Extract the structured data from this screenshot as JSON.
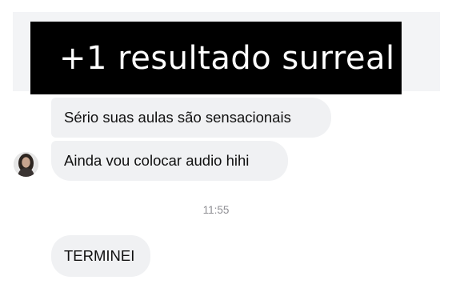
{
  "banner": {
    "text": "+1 resultado surreal"
  },
  "chat": {
    "messages": [
      {
        "text": "Sério suas aulas são sensacionais"
      },
      {
        "text": "Ainda vou colocar audio hihi"
      },
      {
        "text": "TERMINEI"
      }
    ],
    "timestamp": "11:55",
    "avatar_icon": "profile-photo-avatar"
  },
  "colors": {
    "bubble": "#f0f1f3",
    "banner_bg": "#000000",
    "banner_text": "#ffffff",
    "timestamp": "#8e8e93"
  }
}
